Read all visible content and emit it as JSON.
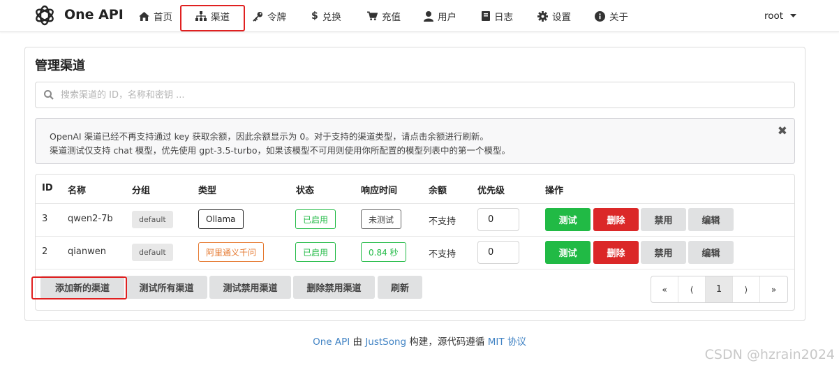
{
  "app": {
    "name": "One API"
  },
  "nav": [
    {
      "label": "首页",
      "icon": "home-icon"
    },
    {
      "label": "渠道",
      "icon": "sitemap-icon"
    },
    {
      "label": "令牌",
      "icon": "key-icon"
    },
    {
      "label": "兑换",
      "icon": "dollar-icon"
    },
    {
      "label": "充值",
      "icon": "cart-icon"
    },
    {
      "label": "用户",
      "icon": "user-icon"
    },
    {
      "label": "日志",
      "icon": "book-icon"
    },
    {
      "label": "设置",
      "icon": "gear-icon"
    },
    {
      "label": "关于",
      "icon": "info-icon"
    }
  ],
  "user": {
    "name": "root"
  },
  "page": {
    "title": "管理渠道",
    "search_placeholder": "搜索渠道的 ID，名称和密钥 ..."
  },
  "notice": {
    "line1": "OpenAI 渠道已经不再支持通过 key 获取余额，因此余额显示为 0。对于支持的渠道类型，请点击余额进行刷新。",
    "line2": "渠道测试仅支持 chat 模型，优先使用 gpt-3.5-turbo，如果该模型不可用则使用你所配置的模型列表中的第一个模型。",
    "close": "✖"
  },
  "table": {
    "headers": [
      "ID",
      "名称",
      "分组",
      "类型",
      "状态",
      "响应时间",
      "余额",
      "优先级",
      "操作"
    ],
    "rows": [
      {
        "id": "3",
        "name": "qwen2-7b",
        "group": "default",
        "type": "Ollama",
        "status": "已启用",
        "response": "未测试",
        "balance": "不支持",
        "priority": "0",
        "actions": [
          "测试",
          "删除",
          "禁用",
          "编辑"
        ]
      },
      {
        "id": "2",
        "name": "qianwen",
        "group": "default",
        "type": "阿里通义千问",
        "status": "已启用",
        "response": "0.84 秒",
        "balance": "不支持",
        "priority": "0",
        "actions": [
          "测试",
          "删除",
          "禁用",
          "编辑"
        ]
      }
    ]
  },
  "footer_buttons": [
    "添加新的渠道",
    "测试所有渠道",
    "测试禁用渠道",
    "删除禁用渠道",
    "刷新"
  ],
  "pagination": {
    "first": "«",
    "prev": "⟨",
    "current": "1",
    "next": "⟩",
    "last": "»"
  },
  "footer": {
    "part1": "One API",
    "part2": " 由 ",
    "part3": "JustSong",
    "part4": " 构建，源代码遵循 ",
    "part5": "MIT 协议"
  },
  "watermark": "CSDN @hzrain2024",
  "colors": {
    "green": "#21ba45",
    "red": "#db2828",
    "orange": "#e5772d",
    "link": "#4183c4",
    "highlight": "#e02020"
  }
}
